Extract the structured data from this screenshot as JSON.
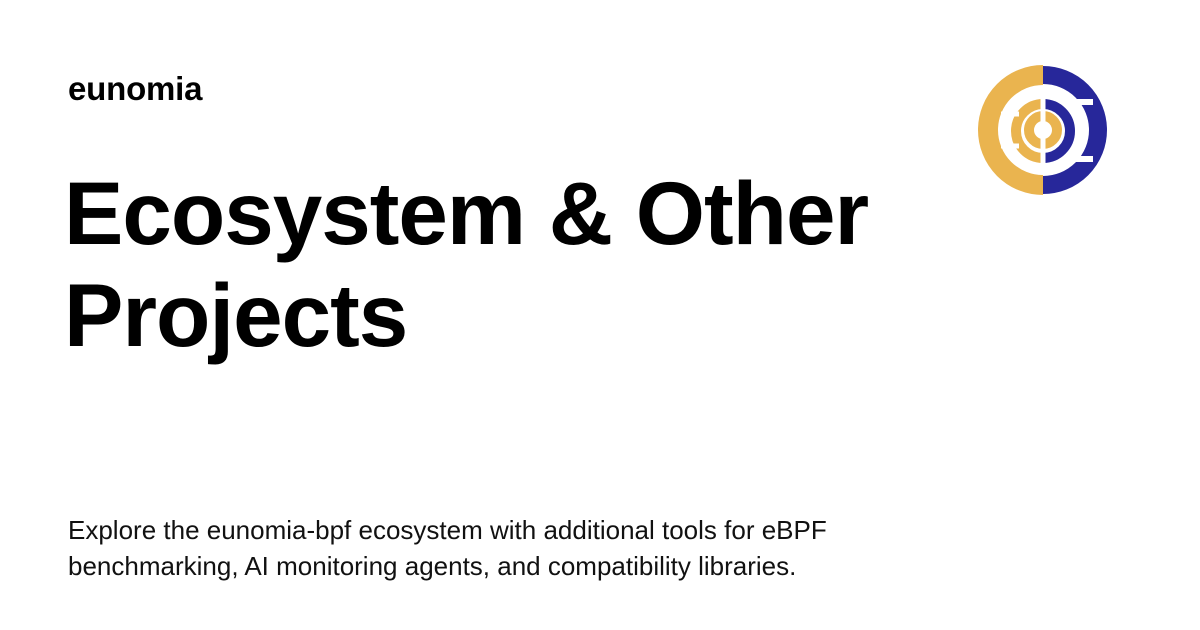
{
  "header": {
    "site_name": "eunomia"
  },
  "main": {
    "title": "Ecosystem & Other Projects",
    "description": "Explore the eunomia-bpf ecosystem with additional tools for eBPF benchmarking, AI monitoring agents, and compatibility libraries."
  },
  "logo": {
    "icon": "eunomia-logo-icon",
    "colors": {
      "left": "#EAB44F",
      "right": "#27279A"
    }
  }
}
